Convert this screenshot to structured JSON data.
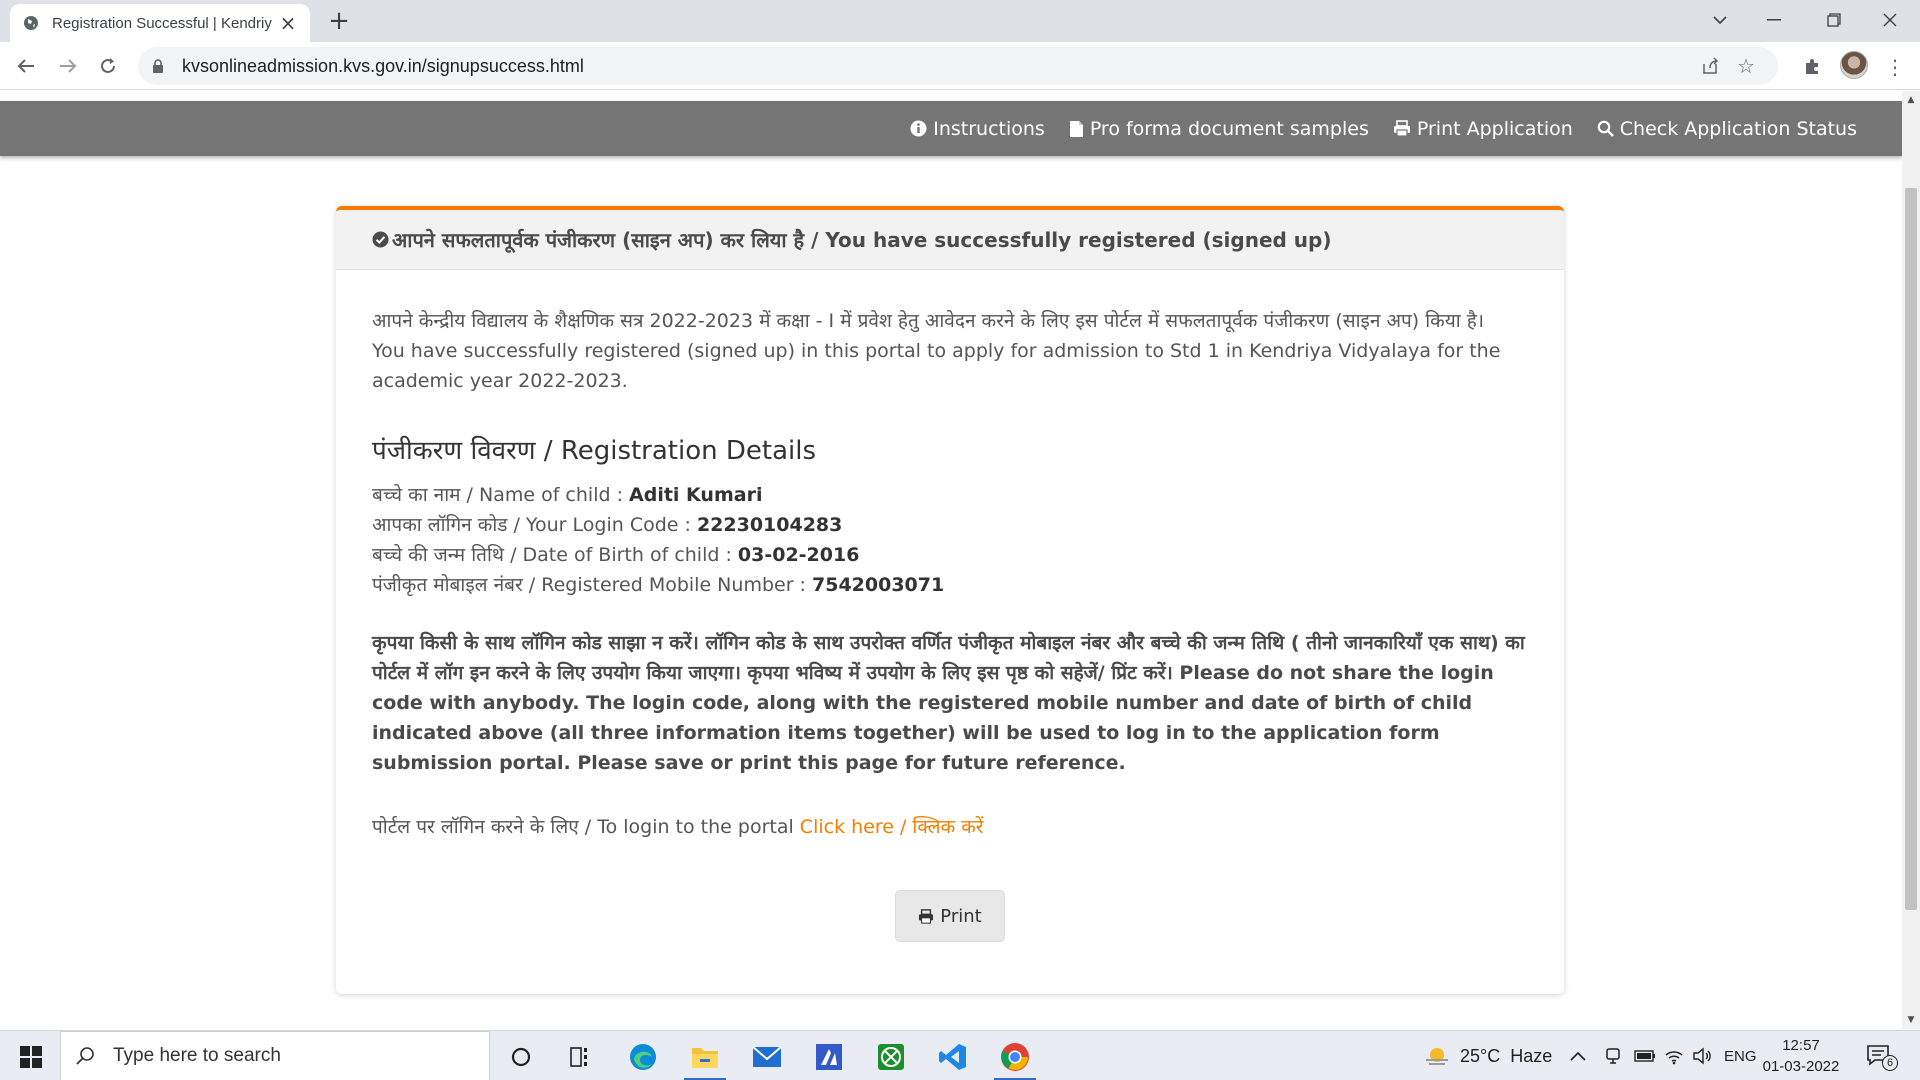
{
  "browser": {
    "tab_title": "Registration Successful | Kendriya",
    "url": "kvsonlineadmission.kvs.gov.in/signupsuccess.html"
  },
  "nav": {
    "items": [
      {
        "label": "Instructions",
        "icon": "info-circle-icon"
      },
      {
        "label": "Pro forma document samples",
        "icon": "file-icon"
      },
      {
        "label": "Print Application",
        "icon": "print-icon"
      },
      {
        "label": "Check Application Status",
        "icon": "search-icon"
      }
    ]
  },
  "card": {
    "header": "आपने सफलतापूर्वक पंजीकरण (साइन अप) कर लिया है / You have successfully registered (signed up)",
    "intro_hindi": "आपने केन्द्रीय विद्यालय के शैक्षणिक सत्र 2022-2023 में कक्षा - I में प्रवेश हेतु आवेदन करने के लिए इस पोर्टल में सफलतापूर्वक पंजीकरण (साइन अप) किया है।",
    "intro_english": "You have successfully registered (signed up) in this portal to apply for admission to Std 1 in Kendriya Vidyalaya for the academic year 2022-2023.",
    "details_heading": "पंजीकरण विवरण / Registration Details",
    "details": [
      {
        "label": "बच्चे का नाम / Name of child : ",
        "value": "Aditi Kumari"
      },
      {
        "label": "आपका लॉगिन कोड / Your Login Code : ",
        "value": "22230104283"
      },
      {
        "label": "बच्चे की जन्म तिथि / Date of Birth of child : ",
        "value": "03-02-2016"
      },
      {
        "label": "पंजीकृत मोबाइल नंबर / Registered Mobile Number : ",
        "value": "7542003071"
      }
    ],
    "warning": "कृपया किसी के साथ लॉगिन कोड साझा न करें। लॉगिन कोड के साथ उपरोक्त वर्णित पंजीकृत मोबाइल नंबर और बच्चे की जन्म तिथि ( तीनो जानकारियाँ एक साथ) का पोर्टल में लॉग इन करने के लिए उपयोग किया जाएगा। कृपया भविष्य में उपयोग के लिए इस पृष्ठ को सहेजें/ प्रिंट करें। Please do not share the login code with anybody. The login code, along with the registered mobile number and date of birth of child indicated above (all three information items together) will be used to log in to the application form submission portal. Please save or print this page for future reference.",
    "login_text": "पोर्टल पर लॉगिन करने के लिए / To login to the portal ",
    "login_link": "Click here / क्लिक करें",
    "print_label": "Print"
  },
  "taskbar": {
    "search_placeholder": "Type here to search",
    "weather": "25°C  Haze",
    "language": "ENG",
    "time": "12:57",
    "date": "01-03-2022",
    "notification_count": "6",
    "apps": [
      "cortana-icon",
      "task-view-icon",
      "edge-icon",
      "file-explorer-icon",
      "mail-icon",
      "app-icon",
      "xbox-icon",
      "vscode-icon",
      "chrome-icon"
    ]
  },
  "colors": {
    "accent": "#f57c00",
    "nav_bg": "#757575"
  }
}
